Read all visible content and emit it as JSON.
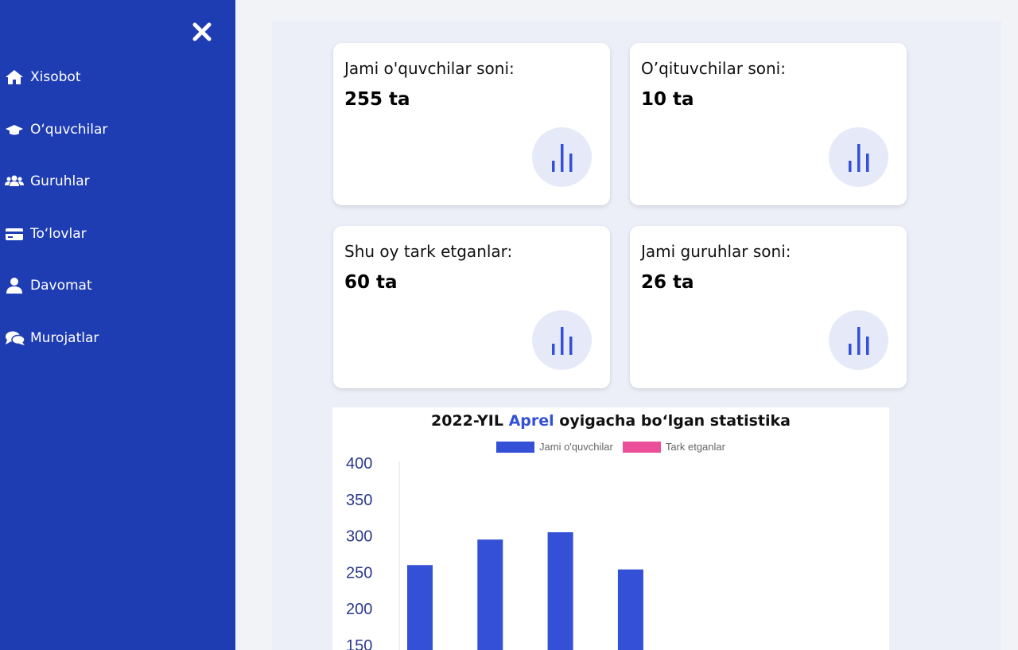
{
  "sidebar": {
    "items": [
      {
        "label": "Xisobot",
        "icon": "home-icon"
      },
      {
        "label": "O‘quvchilar",
        "icon": "graduation-cap-icon"
      },
      {
        "label": "Guruhlar",
        "icon": "users-icon"
      },
      {
        "label": "To‘lovlar",
        "icon": "credit-card-icon"
      },
      {
        "label": "Davomat",
        "icon": "user-icon"
      },
      {
        "label": "Murojatlar",
        "icon": "comments-icon"
      }
    ]
  },
  "cards": [
    {
      "title": "Jami o'quvchilar soni:",
      "value": "255 ta"
    },
    {
      "title": "O’qituvchilar soni:",
      "value": "10 ta"
    },
    {
      "title": "Shu oy tark etganlar:",
      "value": "60 ta"
    },
    {
      "title": "Jami guruhlar soni:",
      "value": "26 ta"
    }
  ],
  "chart": {
    "title_prefix": "2022-YIL",
    "title_month": "Aprel",
    "title_suffix": "oyigacha bo‘lgan statistika"
  },
  "colors": {
    "sidebar": "#1f3db3",
    "accent": "#3350d6",
    "series2": "#ec4f9a"
  },
  "chart_data": {
    "type": "bar",
    "title": "2022-YIL Aprel oyigacha bo‘lgan statistika",
    "series": [
      {
        "name": "Jami o'quvchilar",
        "values": [
          260,
          295,
          305,
          254
        ]
      },
      {
        "name": "Tark etganlar",
        "values": []
      }
    ],
    "yticks": [
      400,
      350,
      300,
      250,
      200,
      150
    ],
    "ylim": [
      100,
      400
    ],
    "legend": "top",
    "grid": false
  }
}
